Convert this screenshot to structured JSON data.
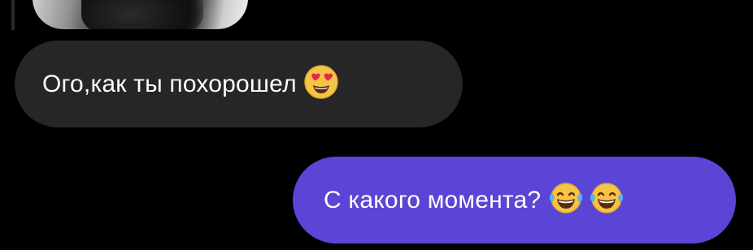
{
  "thread": {
    "messages": [
      {
        "direction": "incoming",
        "text": "Ого,как ты похорошел",
        "emojis": [
          "heart-eyes-emoji"
        ]
      },
      {
        "direction": "outgoing",
        "text": "С какого момента?",
        "emojis": [
          "tears-of-joy-emoji",
          "tears-of-joy-emoji"
        ]
      }
    ]
  },
  "colors": {
    "background": "#000000",
    "incoming_bubble": "#262626",
    "outgoing_bubble": "#5b45d6",
    "text": "#ffffff"
  }
}
